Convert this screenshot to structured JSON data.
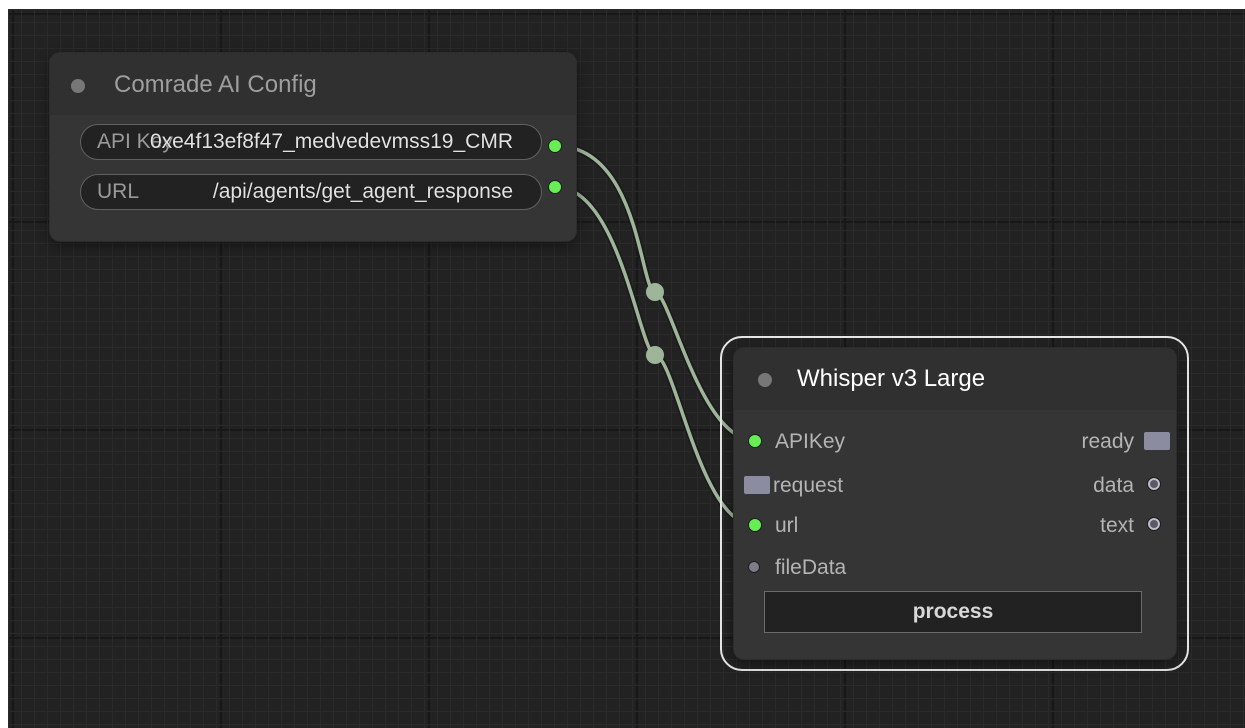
{
  "config_node": {
    "title": "Comrade AI Config",
    "widgets": [
      {
        "label": "API Key",
        "value": "0xe4f13ef8f47_medvedevmss19_CMR"
      },
      {
        "label": "URL",
        "value": "/api/agents/get_agent_response"
      }
    ]
  },
  "whisper_node": {
    "title": "Whisper v3 Large",
    "inputs": [
      "APIKey",
      "request",
      "url",
      "fileData"
    ],
    "outputs": [
      "ready",
      "data",
      "text"
    ],
    "button_label": "process"
  },
  "colors": {
    "canvas_bg": "#222222",
    "node_bg": "#353535",
    "connected_slot": "#66ee55",
    "link": "#9eb59a"
  }
}
